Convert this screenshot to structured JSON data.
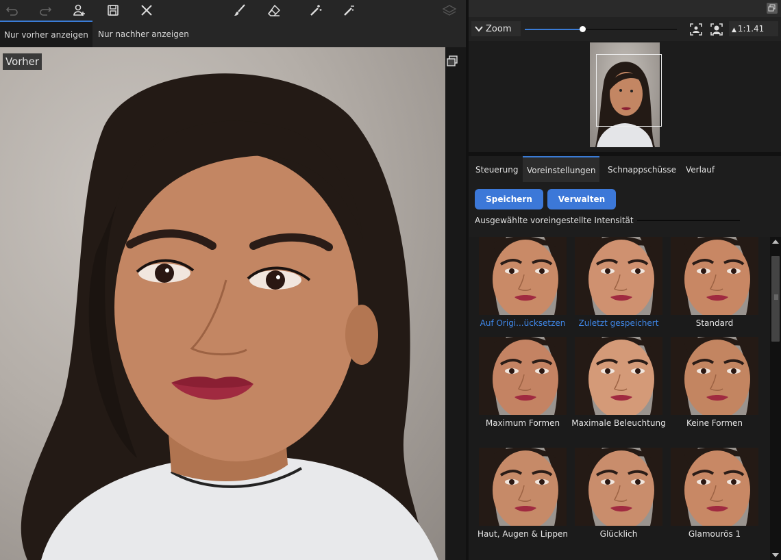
{
  "toolbar": {
    "icons": [
      "undo-icon",
      "redo-icon",
      "add-person-icon",
      "save-icon",
      "close-icon",
      "brush-icon",
      "eraser-icon",
      "magic-wand-plus-icon",
      "magic-wand-minus-icon",
      "layers-icon"
    ]
  },
  "view_tabs": [
    {
      "label": "Nur vorher anzeigen",
      "active": true
    },
    {
      "label": "Nur nachher anzeigen",
      "active": false
    }
  ],
  "preview": {
    "before_label": "Vorher"
  },
  "navigator": {
    "zoom_label": "Zoom",
    "zoom_value": "1:1.41",
    "zoom_slider_fraction": 0.38
  },
  "panel_tabs": [
    {
      "label": "Steuerung",
      "active": false
    },
    {
      "label": "Voreinstellungen",
      "active": true
    },
    {
      "label": "Schnappschüsse",
      "active": false
    },
    {
      "label": "Verlauf",
      "active": false
    }
  ],
  "buttons": {
    "save": "Speichern",
    "manage": "Verwalten"
  },
  "intensity_label": "Ausgewählte voreingestellte Intensität",
  "presets": [
    {
      "label": "Auf Origi...ücksetzen",
      "highlight": true
    },
    {
      "label": "Zuletzt gespeichert",
      "highlight": true
    },
    {
      "label": "Standard",
      "highlight": false
    },
    {
      "label": "Maximum Formen",
      "highlight": false
    },
    {
      "label": "Maximale Beleuchtung",
      "highlight": false
    },
    {
      "label": "Keine Formen",
      "highlight": false
    },
    {
      "label": "Haut, Augen & Lippen",
      "highlight": false
    },
    {
      "label": "Glücklich",
      "highlight": false
    },
    {
      "label": "Glamourös 1",
      "highlight": false
    }
  ],
  "colors": {
    "accent": "#3a7bd5",
    "button": "#3c78d8",
    "highlight_text": "#3f86e6"
  }
}
